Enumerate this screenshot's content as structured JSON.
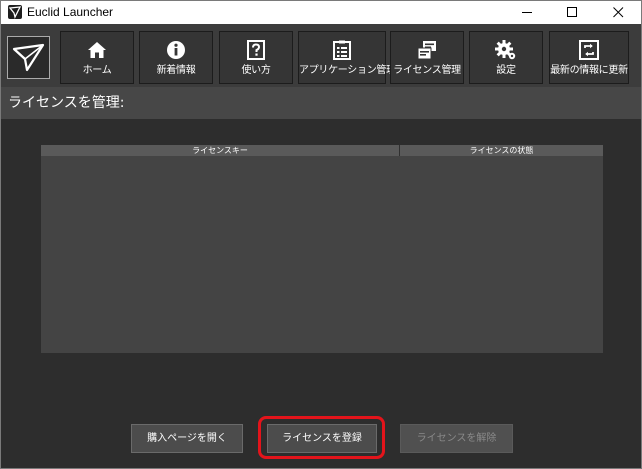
{
  "window": {
    "title": "Euclid Launcher"
  },
  "toolbar": {
    "buttons": [
      {
        "label": "ホーム",
        "icon": "home-icon"
      },
      {
        "label": "新着情報",
        "icon": "info-icon"
      },
      {
        "label": "使い方",
        "icon": "help-icon"
      },
      {
        "label": "アプリケーション管理",
        "icon": "app-list-icon"
      },
      {
        "label": "ライセンス管理",
        "icon": "license-icon"
      },
      {
        "label": "設定",
        "icon": "settings-gear-icon"
      },
      {
        "label": "最新の情報に更新",
        "icon": "refresh-icon"
      }
    ]
  },
  "page": {
    "title": "ライセンスを管理:"
  },
  "table": {
    "columns": [
      "ライセンスキー",
      "ライセンスの状態"
    ],
    "rows": []
  },
  "actions": {
    "open_purchase_page": "購入ページを開く",
    "register_license": "ライセンスを登録",
    "release_license": "ライセンスを解除"
  },
  "colors": {
    "highlight": "#e3141b",
    "background": "#2d2d2d",
    "toolbar": "#3c3c3c"
  }
}
